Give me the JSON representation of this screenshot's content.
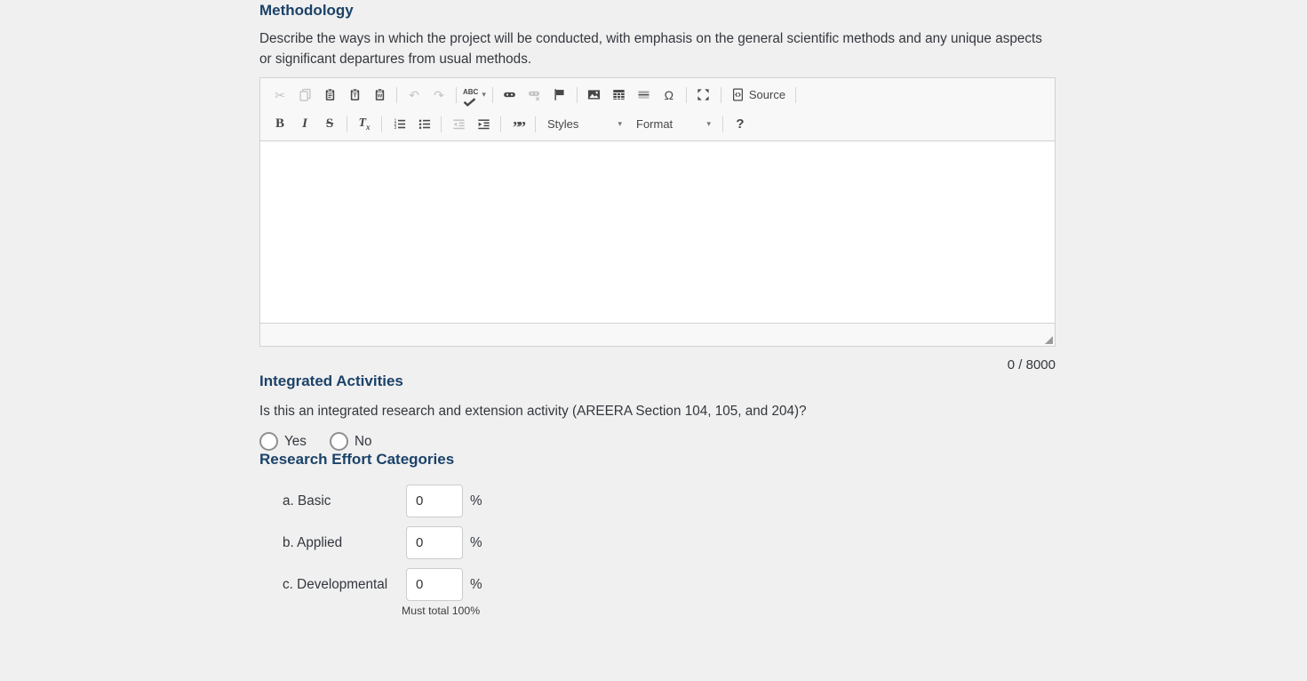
{
  "page": {
    "background": "#f0f0f0"
  },
  "colors": {
    "heading": "#1b4269",
    "body_text": "#33373d",
    "toolbar_icon": "#474747",
    "toolbar_icon_disabled": "#c3c3c3",
    "border": "#d1d1d1",
    "editor_chrome": "#f8f8f8"
  },
  "methodology": {
    "title": "Methodology",
    "description": "Describe the ways in which the project will be conducted, with emphasis on the general scientific methods and any unique aspects or significant departures from usual methods.",
    "editor": {
      "char_counter": "0 / 8000",
      "toolbar_row1": [
        {
          "name": "cut",
          "glyph": "✂",
          "enabled": false
        },
        {
          "name": "copy",
          "enabled": false
        },
        {
          "name": "paste",
          "enabled": true
        },
        {
          "name": "paste-plain-text",
          "enabled": true
        },
        {
          "name": "paste-from-word",
          "enabled": true
        },
        {
          "sep": true
        },
        {
          "name": "undo",
          "glyph": "↶",
          "enabled": false
        },
        {
          "name": "redo",
          "glyph": "↷",
          "enabled": false
        },
        {
          "sep": true
        },
        {
          "name": "spell-check",
          "special": "abc",
          "caret": true,
          "enabled": true
        },
        {
          "sep": true
        },
        {
          "name": "link",
          "enabled": true
        },
        {
          "name": "unlink",
          "enabled": false
        },
        {
          "name": "anchor",
          "enabled": true
        },
        {
          "sep": true
        },
        {
          "name": "image",
          "enabled": true
        },
        {
          "name": "table",
          "enabled": true
        },
        {
          "name": "horizontal-line",
          "enabled": true
        },
        {
          "name": "special-character",
          "glyph": "Ω",
          "enabled": true
        },
        {
          "sep": true
        },
        {
          "name": "maximize",
          "enabled": true
        },
        {
          "sep": true
        },
        {
          "name": "source",
          "label": "Source",
          "enabled": true
        },
        {
          "sep": true
        }
      ],
      "toolbar_row2": [
        {
          "name": "bold",
          "glyph": "B",
          "cls": "g-bold",
          "enabled": true
        },
        {
          "name": "italic",
          "glyph": "I",
          "cls": "g-italic",
          "enabled": true
        },
        {
          "name": "strikethrough",
          "glyph": "S",
          "cls": "g-strike",
          "enabled": true
        },
        {
          "sep": true
        },
        {
          "name": "remove-format",
          "special": "tx",
          "enabled": true
        },
        {
          "sep": true
        },
        {
          "name": "numbered-list",
          "enabled": true
        },
        {
          "name": "bulleted-list",
          "enabled": true
        },
        {
          "sep": true
        },
        {
          "name": "decrease-indent",
          "enabled": false
        },
        {
          "name": "increase-indent",
          "enabled": true
        },
        {
          "sep": true
        },
        {
          "name": "blockquote",
          "glyph": "””",
          "cls": "g-quote",
          "enabled": true
        },
        {
          "sep": true
        },
        {
          "name": "styles-dropdown",
          "dropdown": "Styles",
          "enabled": true
        },
        {
          "name": "format-dropdown",
          "dropdown": "Format",
          "enabled": true
        },
        {
          "sep": true
        },
        {
          "name": "about",
          "glyph": "?",
          "cls": "g-help",
          "enabled": true
        }
      ]
    }
  },
  "integrated_activities": {
    "title": "Integrated Activities",
    "question": "Is this an integrated research and extension activity (AREERA Section 104, 105, and 204)?",
    "options": [
      {
        "label": "Yes",
        "checked": false
      },
      {
        "label": "No",
        "checked": false
      }
    ]
  },
  "research_effort": {
    "title": "Research Effort Categories",
    "rows": [
      {
        "key": "basic",
        "label": "a. Basic",
        "value": "0",
        "unit": "%"
      },
      {
        "key": "applied",
        "label": "b. Applied",
        "value": "0",
        "unit": "%"
      },
      {
        "key": "developmental",
        "label": "c. Developmental",
        "value": "0",
        "unit": "%"
      }
    ],
    "note": "Must total 100%"
  }
}
